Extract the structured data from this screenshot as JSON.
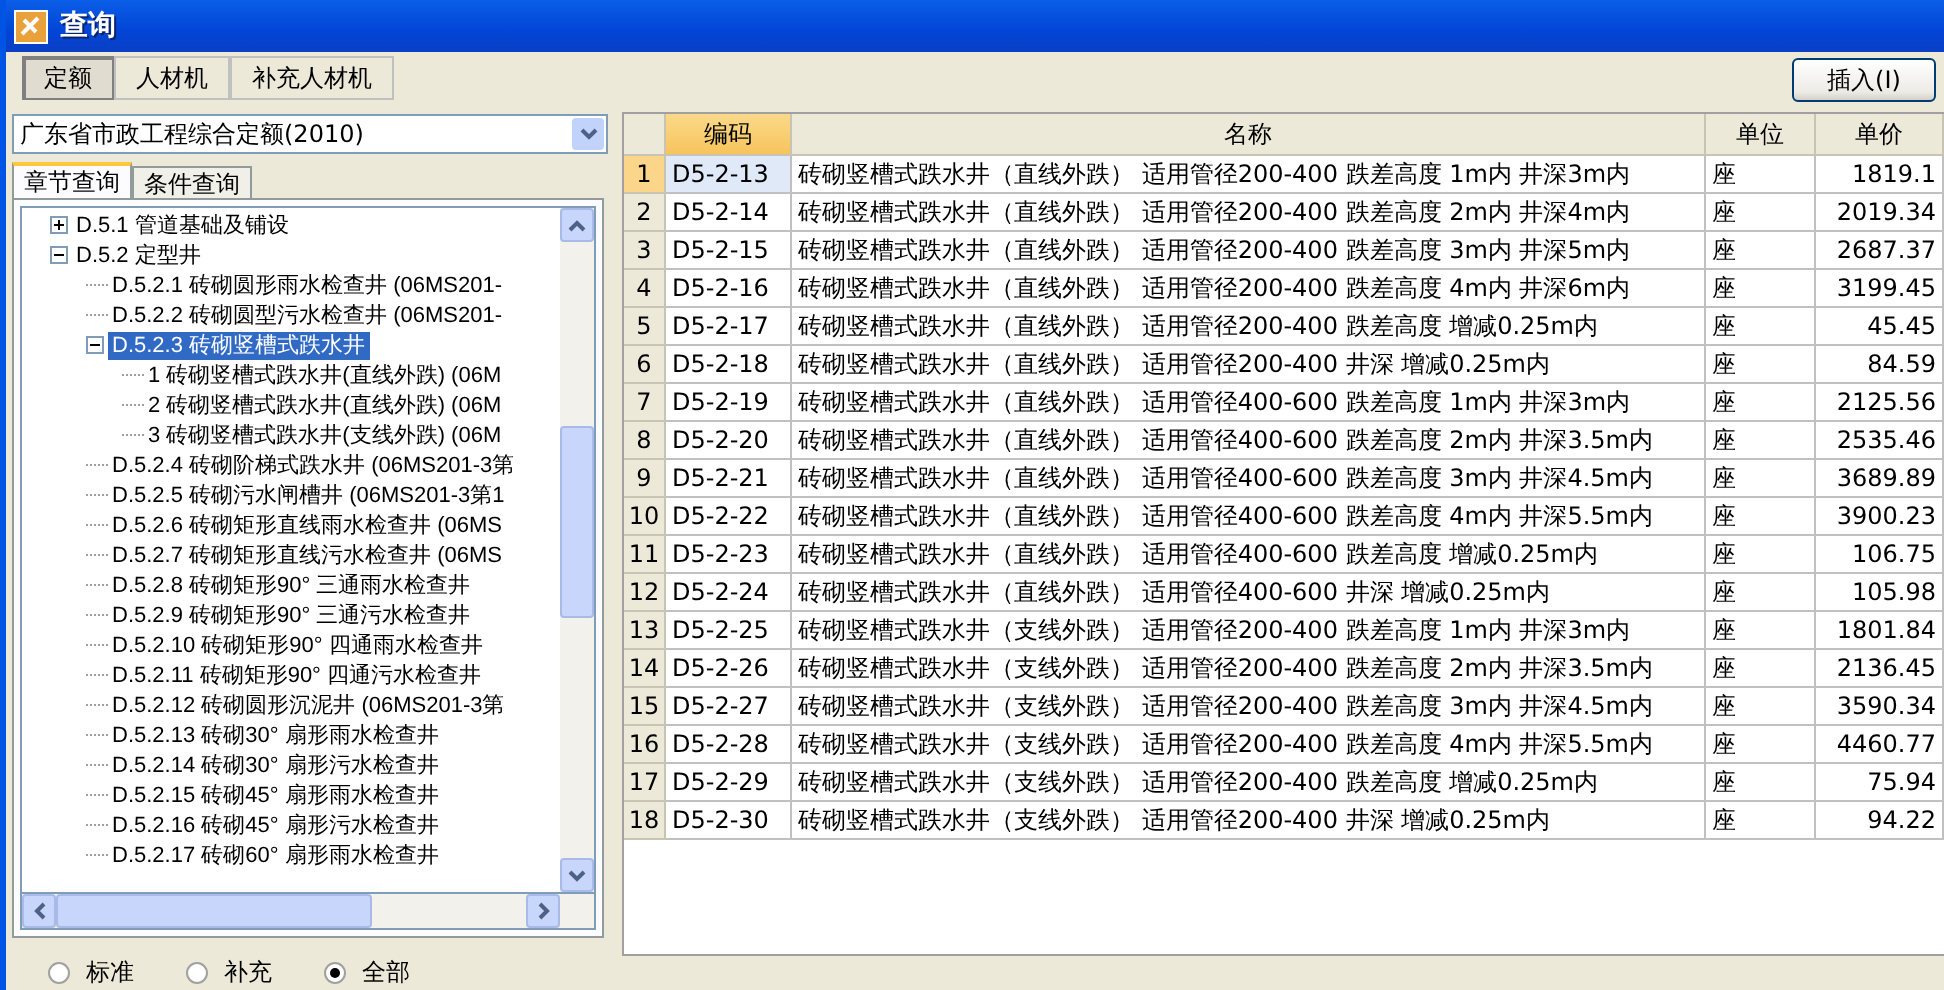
{
  "window": {
    "title": "查询"
  },
  "top_tabs": [
    {
      "label": "定额",
      "selected": true
    },
    {
      "label": "人材机",
      "selected": false
    },
    {
      "label": "补充人材机",
      "selected": false
    }
  ],
  "insert_button": "插入(I)",
  "quota_select": {
    "value": "广东省市政工程综合定额(2010)"
  },
  "query_tabs": [
    {
      "label": "章节查询",
      "selected": true
    },
    {
      "label": "条件查询",
      "selected": false
    }
  ],
  "tree": [
    {
      "label": "D.5.1 管道基础及铺设",
      "selected": false,
      "expanded": false
    },
    {
      "label": "D.5.2 定型井",
      "selected": false,
      "expanded": true,
      "children": [
        {
          "label": "D.5.2.1 砖砌圆形雨水检查井 (06MS201-",
          "selected": false
        },
        {
          "label": "D.5.2.2 砖砌圆型污水检查井 (06MS201-",
          "selected": false
        },
        {
          "label": "D.5.2.3 砖砌竖槽式跌水井",
          "selected": true,
          "expanded": true,
          "children": [
            {
              "label": "1 砖砌竖槽式跌水井(直线外跌) (06M",
              "selected": false
            },
            {
              "label": "2 砖砌竖槽式跌水井(直线外跌) (06M",
              "selected": false
            },
            {
              "label": "3 砖砌竖槽式跌水井(支线外跌) (06M",
              "selected": false
            }
          ]
        },
        {
          "label": "D.5.2.4 砖砌阶梯式跌水井 (06MS201-3第",
          "selected": false
        },
        {
          "label": "D.5.2.5 砖砌污水闸槽井 (06MS201-3第1",
          "selected": false
        },
        {
          "label": "D.5.2.6 砖砌矩形直线雨水检查井 (06MS",
          "selected": false
        },
        {
          "label": "D.5.2.7 砖砌矩形直线污水检查井 (06MS",
          "selected": false
        },
        {
          "label": "D.5.2.8 砖砌矩形90° 三通雨水检查井",
          "selected": false
        },
        {
          "label": "D.5.2.9 砖砌矩形90° 三通污水检查井",
          "selected": false
        },
        {
          "label": "D.5.2.10 砖砌矩形90° 四通雨水检查井",
          "selected": false
        },
        {
          "label": "D.5.2.11 砖砌矩形90° 四通污水检查井",
          "selected": false
        },
        {
          "label": "D.5.2.12 砖砌圆形沉泥井 (06MS201-3第",
          "selected": false
        },
        {
          "label": "D.5.2.13 砖砌30° 扇形雨水检查井",
          "selected": false
        },
        {
          "label": "D.5.2.14 砖砌30° 扇形污水检查井",
          "selected": false
        },
        {
          "label": "D.5.2.15 砖砌45° 扇形雨水检查井",
          "selected": false
        },
        {
          "label": "D.5.2.16 砖砌45° 扇形污水检查井",
          "selected": false
        },
        {
          "label": "D.5.2.17 砖砌60° 扇形雨水检查井",
          "selected": false
        }
      ]
    }
  ],
  "filter_radios": [
    {
      "label": "标准",
      "selected": false
    },
    {
      "label": "补充",
      "selected": false
    },
    {
      "label": "全部",
      "selected": true
    }
  ],
  "table": {
    "columns": [
      {
        "label": "编码",
        "selected": true
      },
      {
        "label": "名称",
        "selected": false
      },
      {
        "label": "单位",
        "selected": false
      },
      {
        "label": "单价",
        "selected": false
      }
    ],
    "rows": [
      {
        "index": "1",
        "code": "D5-2-13",
        "name": "砖砌竖槽式跌水井（直线外跌） 适用管径200-400 跌差高度 1m内 井深3m内",
        "unit": "座",
        "price": "1819.1",
        "selected": true
      },
      {
        "index": "2",
        "code": "D5-2-14",
        "name": "砖砌竖槽式跌水井（直线外跌） 适用管径200-400 跌差高度 2m内 井深4m内",
        "unit": "座",
        "price": "2019.34",
        "selected": false
      },
      {
        "index": "3",
        "code": "D5-2-15",
        "name": "砖砌竖槽式跌水井（直线外跌） 适用管径200-400 跌差高度 3m内 井深5m内",
        "unit": "座",
        "price": "2687.37",
        "selected": false
      },
      {
        "index": "4",
        "code": "D5-2-16",
        "name": "砖砌竖槽式跌水井（直线外跌） 适用管径200-400 跌差高度 4m内 井深6m内",
        "unit": "座",
        "price": "3199.45",
        "selected": false
      },
      {
        "index": "5",
        "code": "D5-2-17",
        "name": "砖砌竖槽式跌水井（直线外跌） 适用管径200-400 跌差高度 增减0.25m内",
        "unit": "座",
        "price": "45.45",
        "selected": false
      },
      {
        "index": "6",
        "code": "D5-2-18",
        "name": "砖砌竖槽式跌水井（直线外跌） 适用管径200-400 井深 增减0.25m内",
        "unit": "座",
        "price": "84.59",
        "selected": false
      },
      {
        "index": "7",
        "code": "D5-2-19",
        "name": "砖砌竖槽式跌水井（直线外跌） 适用管径400-600 跌差高度 1m内 井深3m内",
        "unit": "座",
        "price": "2125.56",
        "selected": false
      },
      {
        "index": "8",
        "code": "D5-2-20",
        "name": "砖砌竖槽式跌水井（直线外跌） 适用管径400-600 跌差高度 2m内 井深3.5m内",
        "unit": "座",
        "price": "2535.46",
        "selected": false
      },
      {
        "index": "9",
        "code": "D5-2-21",
        "name": "砖砌竖槽式跌水井（直线外跌） 适用管径400-600 跌差高度 3m内 井深4.5m内",
        "unit": "座",
        "price": "3689.89",
        "selected": false
      },
      {
        "index": "10",
        "code": "D5-2-22",
        "name": "砖砌竖槽式跌水井（直线外跌） 适用管径400-600 跌差高度 4m内 井深5.5m内",
        "unit": "座",
        "price": "3900.23",
        "selected": false
      },
      {
        "index": "11",
        "code": "D5-2-23",
        "name": "砖砌竖槽式跌水井（直线外跌） 适用管径400-600 跌差高度 增减0.25m内",
        "unit": "座",
        "price": "106.75",
        "selected": false
      },
      {
        "index": "12",
        "code": "D5-2-24",
        "name": "砖砌竖槽式跌水井（直线外跌） 适用管径400-600 井深 增减0.25m内",
        "unit": "座",
        "price": "105.98",
        "selected": false
      },
      {
        "index": "13",
        "code": "D5-2-25",
        "name": "砖砌竖槽式跌水井（支线外跌） 适用管径200-400 跌差高度 1m内 井深3m内",
        "unit": "座",
        "price": "1801.84",
        "selected": false
      },
      {
        "index": "14",
        "code": "D5-2-26",
        "name": "砖砌竖槽式跌水井（支线外跌） 适用管径200-400 跌差高度 2m内 井深3.5m内",
        "unit": "座",
        "price": "2136.45",
        "selected": false
      },
      {
        "index": "15",
        "code": "D5-2-27",
        "name": "砖砌竖槽式跌水井（支线外跌） 适用管径200-400 跌差高度 3m内 井深4.5m内",
        "unit": "座",
        "price": "3590.34",
        "selected": false
      },
      {
        "index": "16",
        "code": "D5-2-28",
        "name": "砖砌竖槽式跌水井（支线外跌） 适用管径200-400 跌差高度 4m内 井深5.5m内",
        "unit": "座",
        "price": "4460.77",
        "selected": false
      },
      {
        "index": "17",
        "code": "D5-2-29",
        "name": "砖砌竖槽式跌水井（支线外跌） 适用管径200-400 跌差高度 增减0.25m内",
        "unit": "座",
        "price": "75.94",
        "selected": false
      },
      {
        "index": "18",
        "code": "D5-2-30",
        "name": "砖砌竖槽式跌水井（支线外跌） 适用管径200-400 井深 增减0.25m内",
        "unit": "座",
        "price": "94.22",
        "selected": false
      }
    ]
  }
}
